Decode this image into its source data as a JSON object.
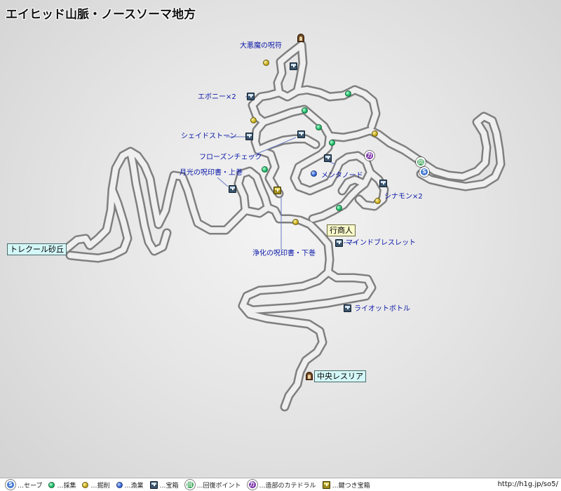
{
  "title": "エイヒッド山脈・ノースソーマ地方",
  "areas": [
    {
      "id": "torekuru",
      "label": "トレクール砂丘"
    },
    {
      "id": "chuou",
      "label": "中央レスリア"
    }
  ],
  "merchant": {
    "label": "行商人"
  },
  "chests": [
    {
      "id": "daiakuma",
      "label": "大悪魔の呪符"
    },
    {
      "id": "ebony",
      "label": "エボニー×2"
    },
    {
      "id": "shadestone",
      "label": "シェイドストーン"
    },
    {
      "id": "frozen",
      "label": "フローズンチェック"
    },
    {
      "id": "gekkou",
      "label": "月光の呪印書・上巻"
    },
    {
      "id": "mentanode",
      "label": "メンタノード"
    },
    {
      "id": "cinnamon",
      "label": "シナモン×2"
    },
    {
      "id": "mind",
      "label": "マインドブレスレット"
    },
    {
      "id": "lion",
      "label": "ライオットボトル"
    },
    {
      "id": "jouka",
      "label": "浄化の呪印書・下巻"
    }
  ],
  "legend": [
    {
      "id": "save",
      "label": "…セーブ",
      "icon": "save-icon",
      "glyph": "S"
    },
    {
      "id": "gather",
      "label": "…採集",
      "icon": "gather-point-icon"
    },
    {
      "id": "mine",
      "label": "…掘削",
      "icon": "mining-point-icon"
    },
    {
      "id": "fish",
      "label": "…漁業",
      "icon": "fishing-point-icon"
    },
    {
      "id": "chest",
      "label": "…宝箱",
      "icon": "treasure-chest-icon"
    },
    {
      "id": "recovery",
      "label": "…回復ポイント",
      "icon": "recovery-point-icon",
      "glyph": "回"
    },
    {
      "id": "cathedral",
      "label": "…造部のカテドラル",
      "icon": "cathedral-icon",
      "glyph": "カ"
    },
    {
      "id": "locked",
      "label": "…鍵つき宝箱",
      "icon": "locked-chest-icon"
    }
  ],
  "site_url": "http://h1g.jp/so5/",
  "colors": {
    "gather": "#16b560",
    "mine": "#c0a413",
    "fish": "#2e62d8",
    "save": "#3f76d2",
    "recovery": "#2b9f4b",
    "cathedral": "#7a32a8",
    "item_label": "#0a17a8",
    "area_bg": "#d4f7f7",
    "merchant_bg": "#fafacb"
  }
}
